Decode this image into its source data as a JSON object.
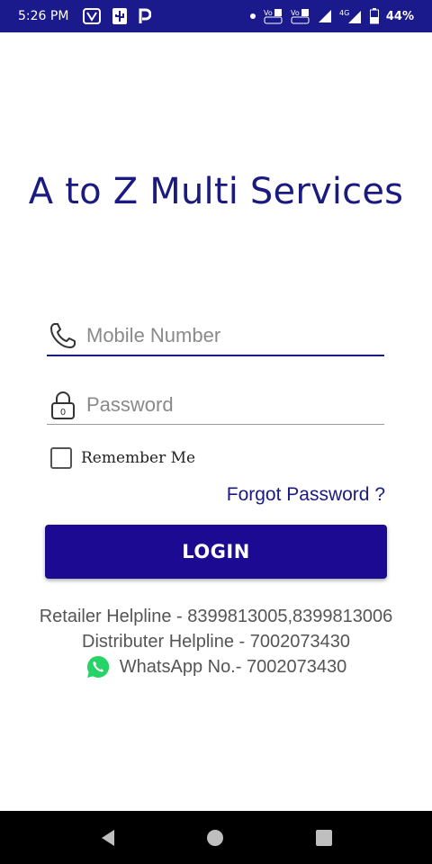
{
  "status_bar": {
    "time": "5:26 PM",
    "battery_percent": "44%",
    "network": "4G",
    "left_icons": [
      "video-app-icon",
      "usb-icon",
      "paytm-icon"
    ],
    "right_icons": [
      "dot-icon",
      "volte-sim1-icon",
      "volte-sim2-icon",
      "signal-icon",
      "signal-4g-icon",
      "battery-icon"
    ]
  },
  "app": {
    "title": "A to Z Multi Services"
  },
  "form": {
    "mobile_placeholder": "Mobile Number",
    "password_placeholder": "Password",
    "remember_label": "Remember Me",
    "remember_checked": false,
    "forgot_label": "Forgot Password ?",
    "login_label": "LOGIN"
  },
  "colors": {
    "brand": "#1c0a92",
    "title": "#1a1a80",
    "status_bar": "#1a1a8c",
    "whatsapp": "#25d366"
  },
  "helplines": {
    "retailer": "Retailer Helpline - 8399813005,8399813006",
    "distributer": "Distributer Helpline - 7002073430",
    "whatsapp": "WhatsApp No.- 7002073430"
  },
  "nav": {
    "icons": [
      "back-icon",
      "home-icon",
      "recents-icon"
    ]
  }
}
